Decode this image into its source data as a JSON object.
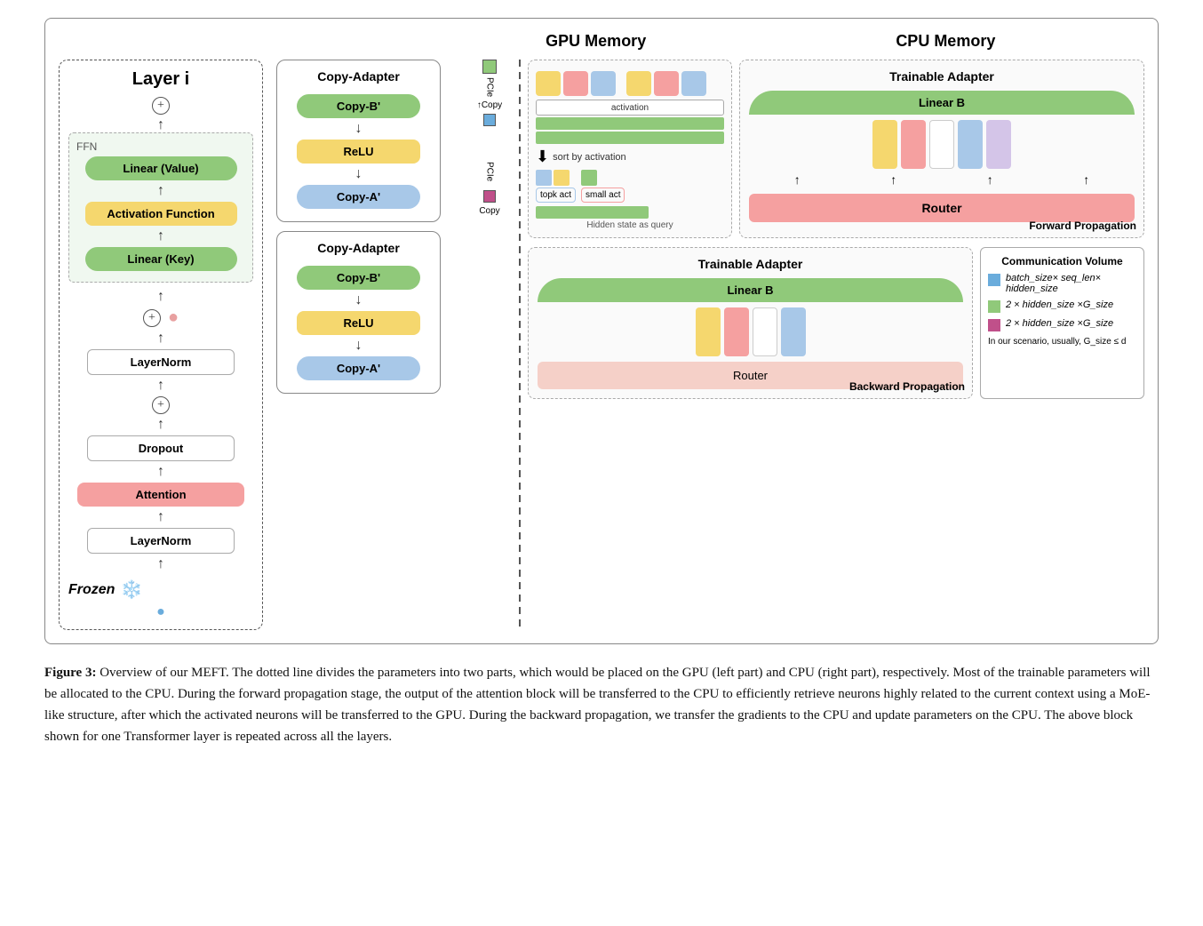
{
  "diagram": {
    "gpu_memory_label": "GPU Memory",
    "cpu_memory_label": "CPU Memory",
    "layer_title": "Layer i",
    "frozen_label": "Frozen",
    "ffn_label": "FFN",
    "layer_components": {
      "linear_value": "Linear (Value)",
      "activation_function": "Activation Function",
      "linear_key": "Linear (Key)",
      "layernorm_top": "LayerNorm",
      "dropout": "Dropout",
      "attention": "Attention",
      "layernorm_bottom": "LayerNorm"
    },
    "copy_adapter_forward": {
      "title": "Copy-Adapter",
      "copy_b": "Copy-B'",
      "relu": "ReLU",
      "copy_a": "Copy-A'"
    },
    "copy_adapter_backward": {
      "title": "Copy-Adapter",
      "copy_b": "Copy-B'",
      "relu": "ReLU",
      "copy_a": "Copy-A'"
    },
    "pcie_label": "PCIe",
    "copy_label": "Copy",
    "activation_label": "activation",
    "sort_by_activation": "sort by activation",
    "topk_act_label": "topk act",
    "small_act_label": "small act",
    "hidden_state_label": "Hidden state as query",
    "trainable_adapter_forward": {
      "title": "Trainable Adapter",
      "linear_b": "Linear B",
      "router": "Router",
      "forward_prop": "Forward Propagation"
    },
    "trainable_adapter_backward": {
      "title": "Trainable Adapter",
      "linear_b": "Linear B",
      "router": "Router",
      "backward_prop": "Backward Propagation"
    },
    "legend": {
      "title": "Communication Volume",
      "item1": "batch_size× seq_len× hidden_size",
      "item2": "2 × hidden_size ×G_size",
      "item3": "2 × hidden_size ×G_size",
      "item4": "In our scenario, usually, G_size ≤ d"
    }
  },
  "caption": {
    "figure_num": "Figure 3:",
    "text": "Overview of our MEFT. The dotted line divides the parameters into two parts, which would be placed on the GPU (left part) and CPU (right part), respectively. Most of the trainable parameters will be allocated to the CPU. During the forward propagation stage, the output of the attention block will be transferred to the CPU to efficiently retrieve neurons highly related to the current context using a MoE-like structure, after which the activated neurons will be transferred to the GPU. During the backward propagation, we transfer the gradients to the CPU and update parameters on the CPU. The above block shown for one Transformer layer is repeated across all the layers."
  },
  "colors": {
    "green": "#90c97a",
    "yellow": "#f5d76e",
    "blue": "#a8c8e8",
    "pink": "#f5a0a0",
    "lavender": "#d4c5e8",
    "light_green_bg": "#e8f5e0"
  }
}
